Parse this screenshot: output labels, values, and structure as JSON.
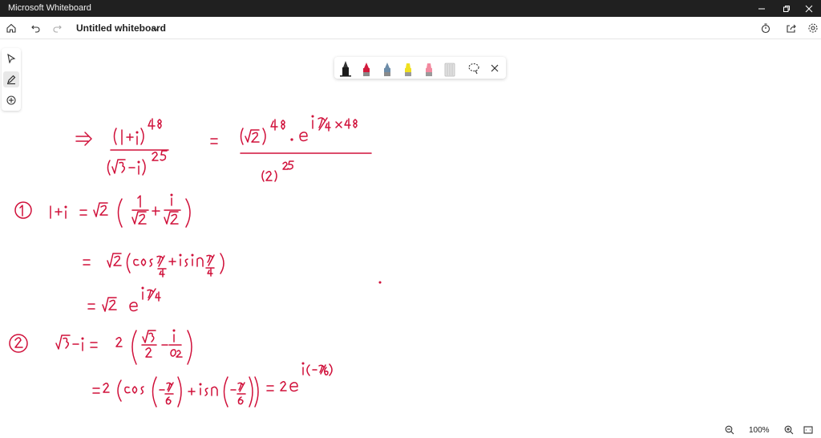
{
  "window": {
    "app_title": "Microsoft Whiteboard"
  },
  "toolbar": {
    "board_title": "Untitled whiteboard"
  },
  "pen_tray": {
    "pens": [
      {
        "name": "black-pen",
        "color": "#1a1a1a"
      },
      {
        "name": "red-pen",
        "color": "#d21a3c"
      },
      {
        "name": "blue-pen",
        "color": "#6c8ca8"
      },
      {
        "name": "yellow-highlighter",
        "color": "#f0e020"
      },
      {
        "name": "pink-highlighter",
        "color": "#f28aa0"
      },
      {
        "name": "eraser",
        "color": "#cfcfcf"
      }
    ]
  },
  "zoom": {
    "level": "100%"
  },
  "ink_color": "#d0103a",
  "accent": "#202020"
}
